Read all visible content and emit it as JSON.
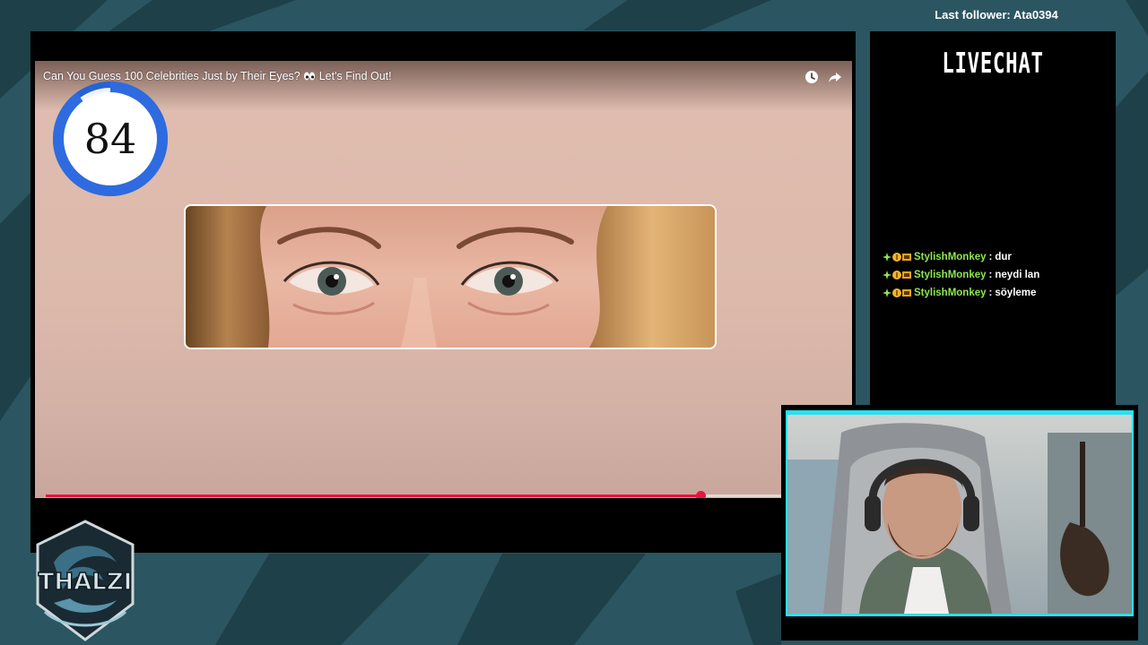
{
  "overlay": {
    "last_follower": "Last follower: Ata0394",
    "logo_text": "THALZI"
  },
  "video": {
    "title": "Can You Guess 100 Celebrities Just by Their Eyes?",
    "title_suffix": "Let's Find Out!",
    "title_emoji_icon": "eyes-emoji-icon",
    "countdown": "84",
    "countdown_remaining_fraction": 0.9,
    "progress_fraction": 0.88,
    "progress_color": "#e8133f",
    "icons": [
      "watch-later-icon",
      "share-icon"
    ]
  },
  "chat": {
    "title": "LIVECHAT",
    "messages": [
      {
        "user": "StylishMonkey",
        "text": "dur"
      },
      {
        "user": "StylishMonkey",
        "text": "neydi lan"
      },
      {
        "user": "StylishMonkey",
        "text": "söyleme"
      }
    ],
    "user_color": "#8ee653"
  },
  "colors": {
    "background": "#2b5560",
    "cam_border": "#29e0f0",
    "timer_ring": "#2563d6"
  }
}
